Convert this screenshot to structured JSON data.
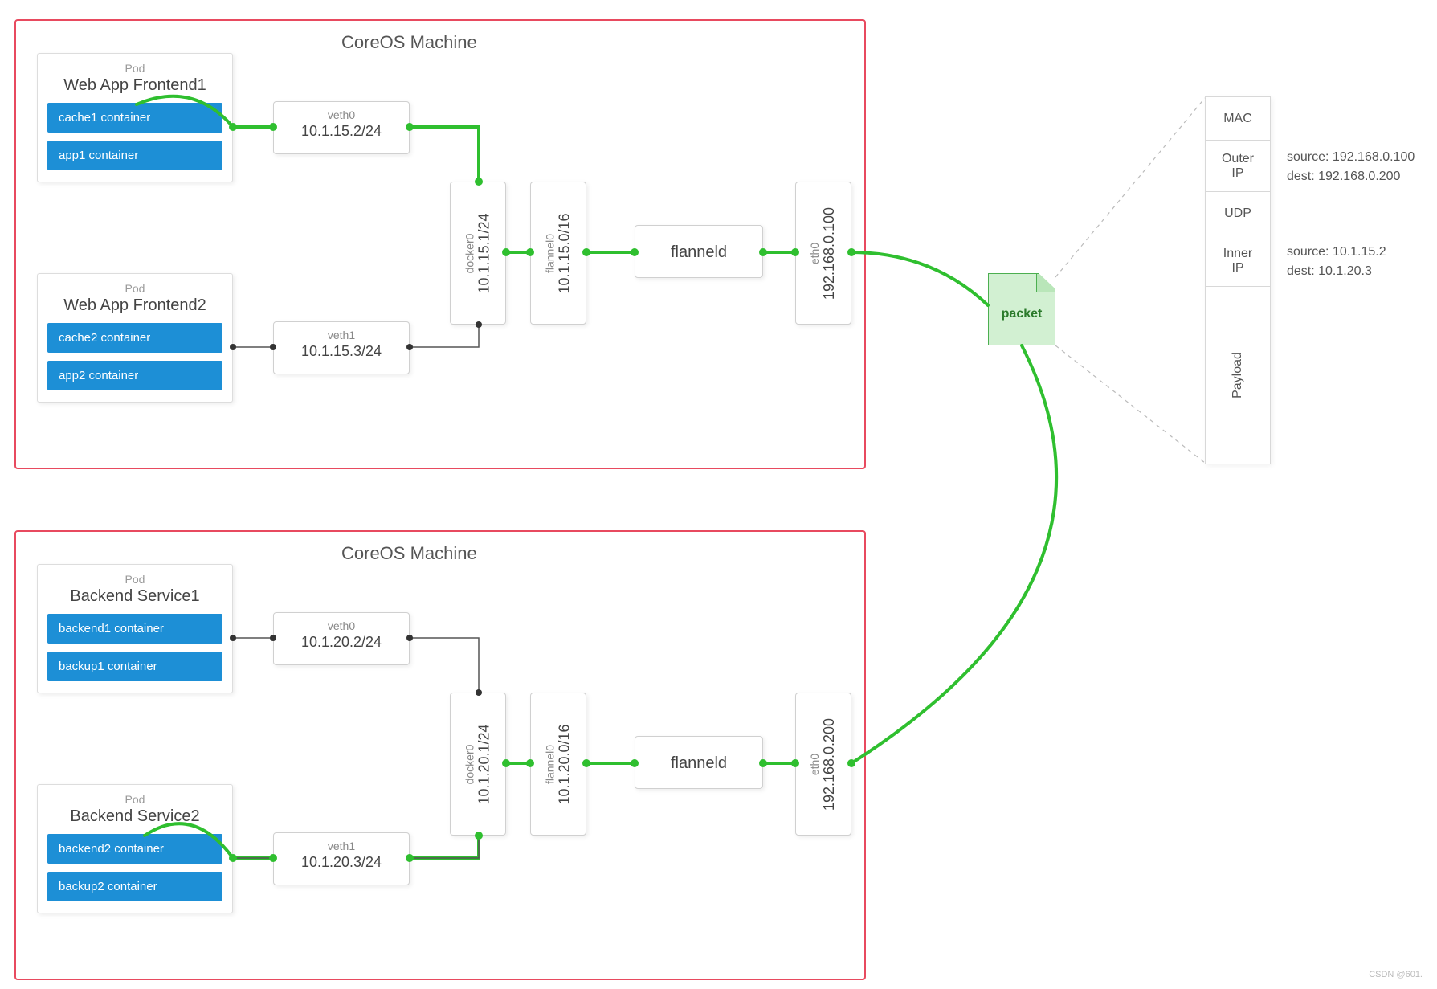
{
  "machines": [
    {
      "title": "CoreOS Machine",
      "pods": [
        {
          "label": "Pod",
          "name": "Web App Frontend1",
          "containers": [
            "cache1 container",
            "app1 container"
          ]
        },
        {
          "label": "Pod",
          "name": "Web App Frontend2",
          "containers": [
            "cache2 container",
            "app2 container"
          ]
        }
      ],
      "veths": [
        {
          "name": "veth0",
          "ip": "10.1.15.2/24"
        },
        {
          "name": "veth1",
          "ip": "10.1.15.3/24"
        }
      ],
      "docker0": {
        "name": "docker0",
        "ip": "10.1.15.1/24"
      },
      "flannel0": {
        "name": "flannel0",
        "ip": "10.1.15.0/16"
      },
      "flanneld": "flanneld",
      "eth0": {
        "name": "eth0",
        "ip": "192.168.0.100"
      }
    },
    {
      "title": "CoreOS Machine",
      "pods": [
        {
          "label": "Pod",
          "name": "Backend Service1",
          "containers": [
            "backend1 container",
            "backup1 container"
          ]
        },
        {
          "label": "Pod",
          "name": "Backend Service2",
          "containers": [
            "backend2 container",
            "backup2 container"
          ]
        }
      ],
      "veths": [
        {
          "name": "veth0",
          "ip": "10.1.20.2/24"
        },
        {
          "name": "veth1",
          "ip": "10.1.20.3/24"
        }
      ],
      "docker0": {
        "name": "docker0",
        "ip": "10.1.20.1/24"
      },
      "flannel0": {
        "name": "flannel0",
        "ip": "10.1.20.0/16"
      },
      "flanneld": "flanneld",
      "eth0": {
        "name": "eth0",
        "ip": "192.168.0.200"
      }
    }
  ],
  "packet_label": "packet",
  "packet_stack": {
    "mac": "MAC",
    "outer_ip": "Outer\nIP",
    "udp": "UDP",
    "inner_ip": "Inner\nIP",
    "payload": "Payload"
  },
  "outer_ip_detail": {
    "source": "source: 192.168.0.100",
    "dest": "dest: 192.168.0.200"
  },
  "inner_ip_detail": {
    "source": "source: 10.1.15.2",
    "dest": "dest: 10.1.20.3"
  },
  "watermark": "CSDN @601."
}
